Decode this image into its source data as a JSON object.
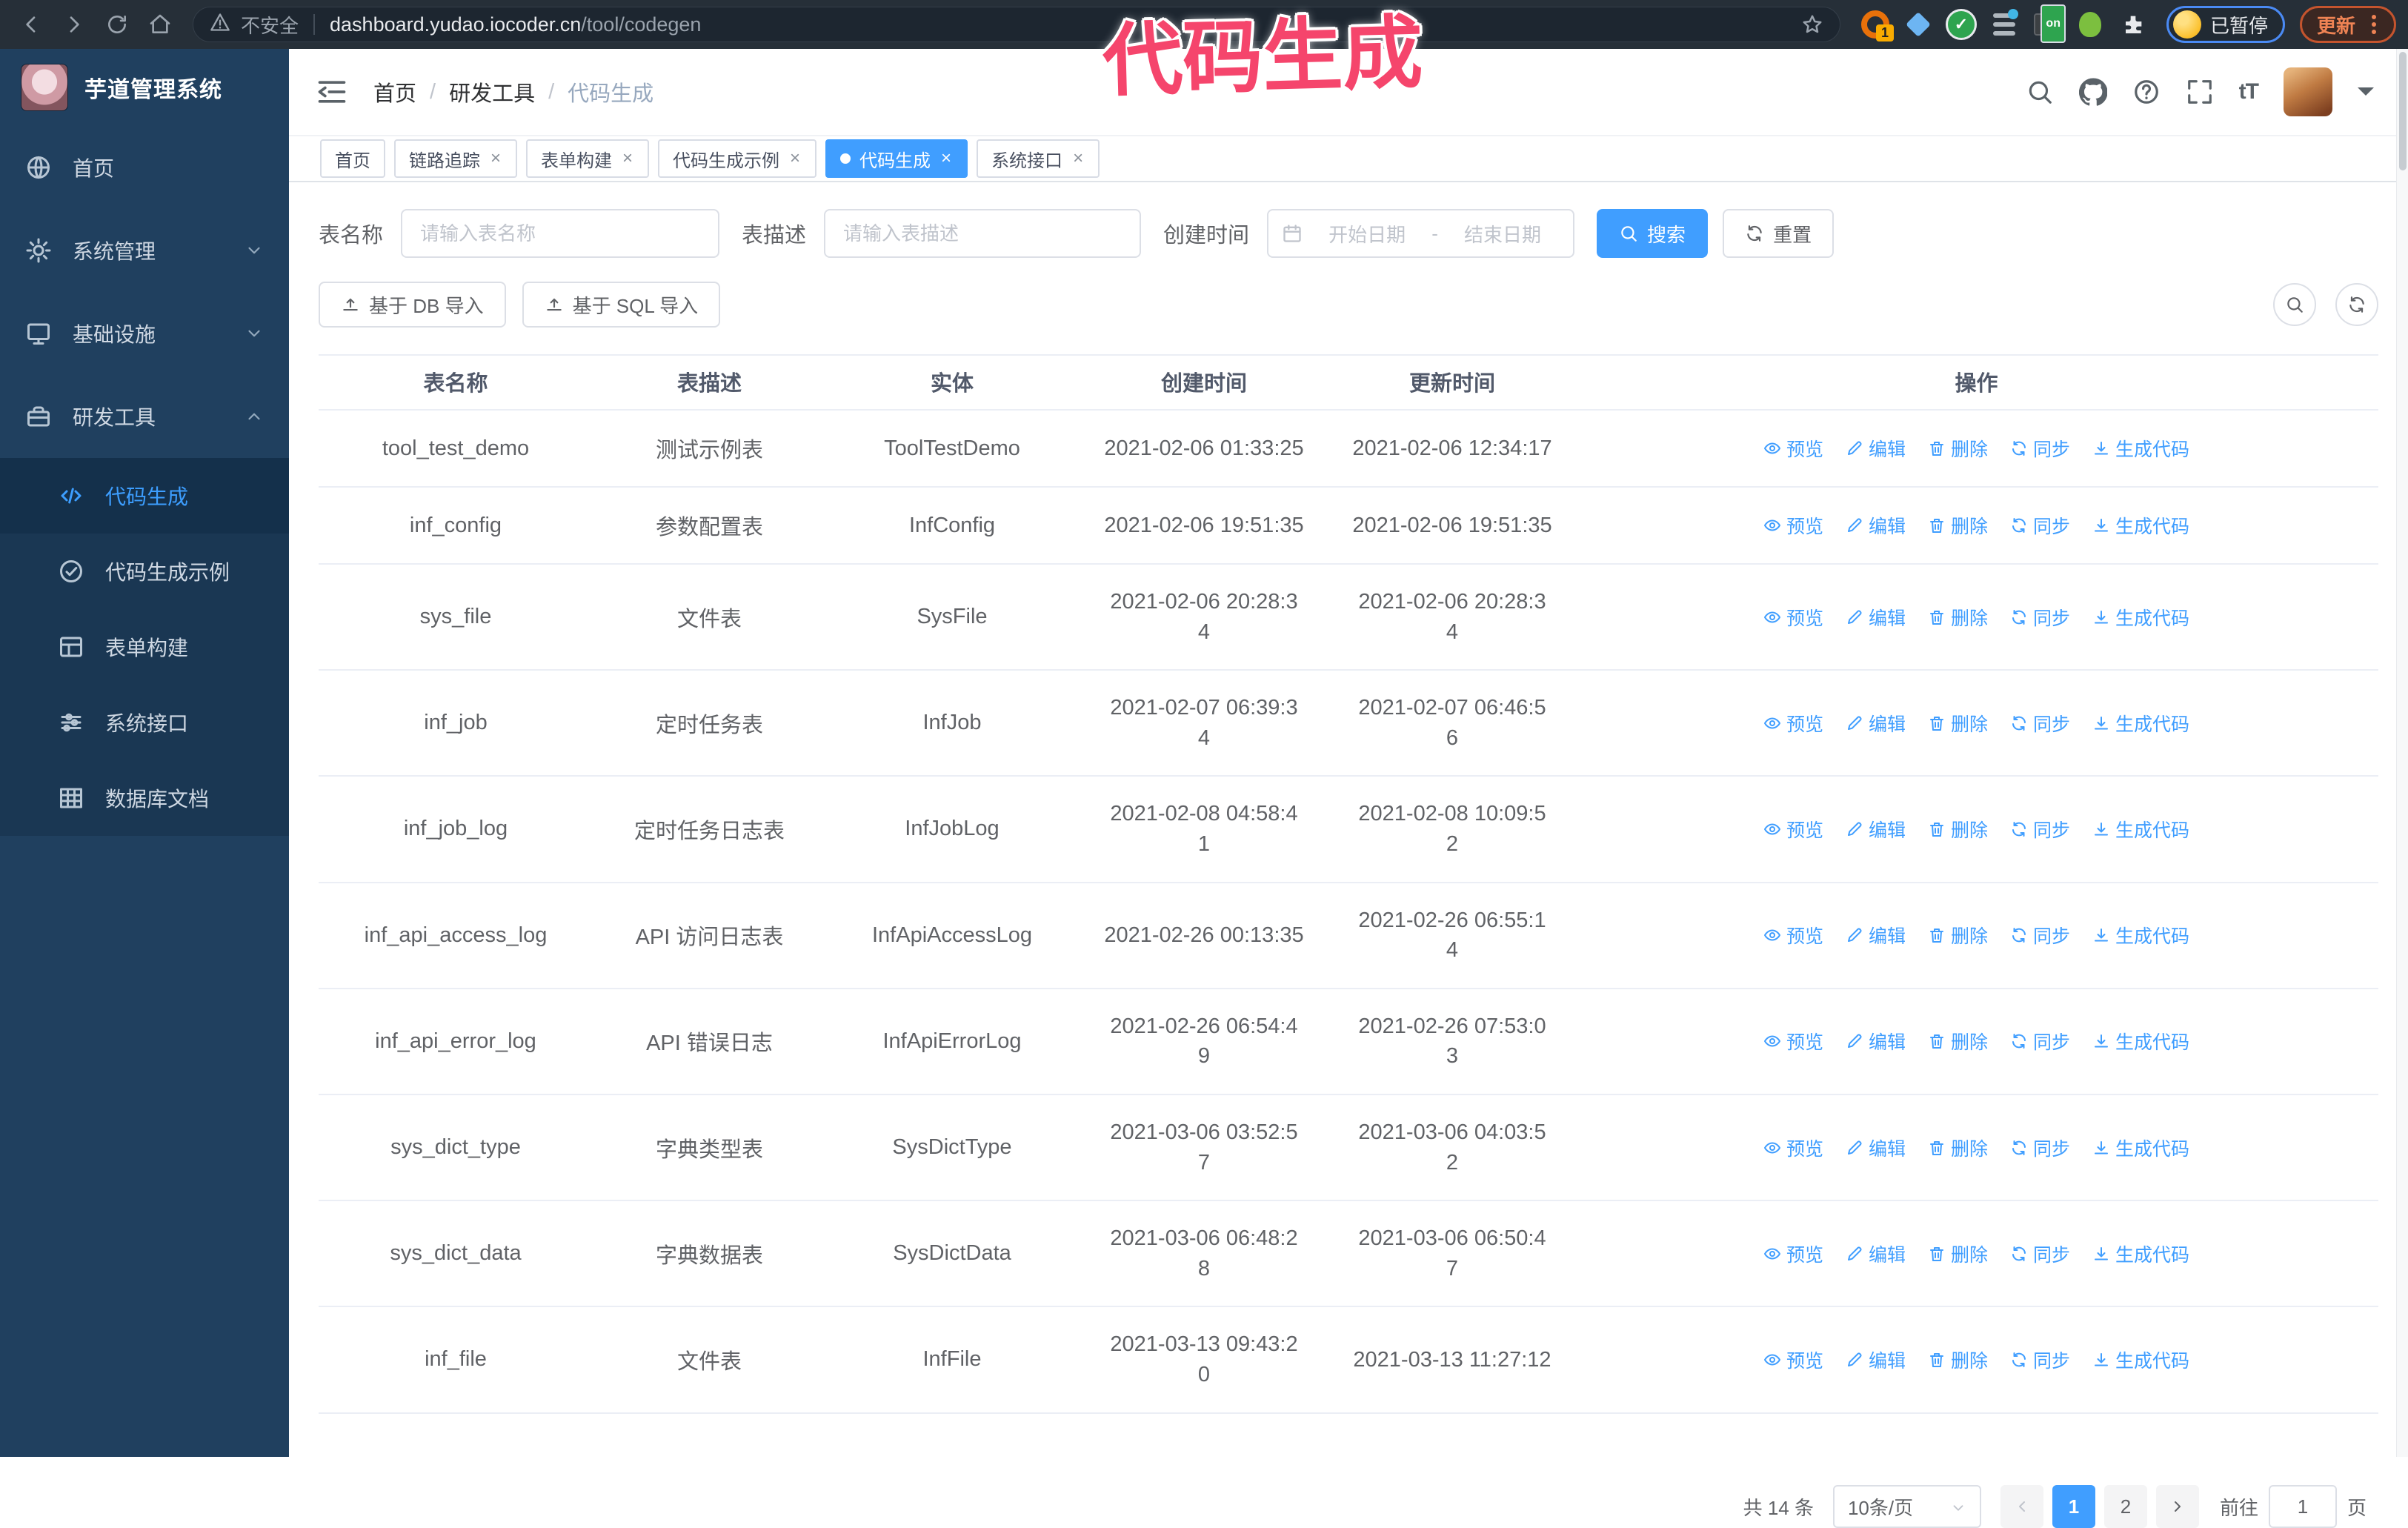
{
  "annotation": {
    "text": "代码生成"
  },
  "browser": {
    "security_label": "不安全",
    "url_host": "dashboard.yudao.iocoder.cn",
    "url_path": "/tool/codegen",
    "paused_badge": "已暂停",
    "update_button": "更新"
  },
  "sidebar": {
    "title": "芋道管理系统",
    "items": [
      {
        "key": "home",
        "icon": "dashboard",
        "label": "首页"
      },
      {
        "key": "system",
        "icon": "gear",
        "label": "系统管理",
        "chevron": "down"
      },
      {
        "key": "infra",
        "icon": "monitor",
        "label": "基础设施",
        "chevron": "down"
      },
      {
        "key": "devtools",
        "icon": "briefcase",
        "label": "研发工具",
        "chevron": "up",
        "expanded": true
      }
    ],
    "subitems": [
      {
        "key": "codegen",
        "icon": "code",
        "label": "代码生成",
        "active": true
      },
      {
        "key": "codegen-example",
        "icon": "badge",
        "label": "代码生成示例"
      },
      {
        "key": "form-builder",
        "icon": "form",
        "label": "表单构建"
      },
      {
        "key": "api",
        "icon": "sliders",
        "label": "系统接口"
      },
      {
        "key": "db-doc",
        "icon": "dbdoc",
        "label": "数据库文档"
      }
    ]
  },
  "header": {
    "breadcrumb": [
      "首页",
      "研发工具",
      "代码生成"
    ]
  },
  "tabs": [
    {
      "key": "home",
      "label": "首页",
      "closable": false,
      "active": false
    },
    {
      "key": "tracer",
      "label": "链路追踪",
      "closable": true,
      "active": false
    },
    {
      "key": "form-builder",
      "label": "表单构建",
      "closable": true,
      "active": false
    },
    {
      "key": "codegen-example",
      "label": "代码生成示例",
      "closable": true,
      "active": false
    },
    {
      "key": "codegen",
      "label": "代码生成",
      "closable": true,
      "active": true
    },
    {
      "key": "api",
      "label": "系统接口",
      "closable": true,
      "active": false
    }
  ],
  "filters": {
    "table_name_label": "表名称",
    "table_name_placeholder": "请输入表名称",
    "table_desc_label": "表描述",
    "table_desc_placeholder": "请输入表描述",
    "create_time_label": "创建时间",
    "date_start_placeholder": "开始日期",
    "date_separator": "-",
    "date_end_placeholder": "结束日期",
    "search_label": "搜索",
    "reset_label": "重置"
  },
  "toolbar": {
    "import_db_label": "基于 DB 导入",
    "import_sql_label": "基于 SQL 导入"
  },
  "table": {
    "columns": [
      "表名称",
      "表描述",
      "实体",
      "创建时间",
      "更新时间",
      "操作"
    ],
    "actions": [
      "预览",
      "编辑",
      "删除",
      "同步",
      "生成代码"
    ],
    "rows": [
      {
        "name": "tool_test_demo",
        "desc": "测试示例表",
        "entity": "ToolTestDemo",
        "created": "2021-02-06 01:33:25",
        "updated": "2021-02-06 12:34:17"
      },
      {
        "name": "inf_config",
        "desc": "参数配置表",
        "entity": "InfConfig",
        "created": "2021-02-06 19:51:35",
        "updated": "2021-02-06 19:51:35"
      },
      {
        "name": "sys_file",
        "desc": "文件表",
        "entity": "SysFile",
        "created": "2021-02-06 20:28:3\n4",
        "updated": "2021-02-06 20:28:3\n4"
      },
      {
        "name": "inf_job",
        "desc": "定时任务表",
        "entity": "InfJob",
        "created": "2021-02-07 06:39:3\n4",
        "updated": "2021-02-07 06:46:5\n6"
      },
      {
        "name": "inf_job_log",
        "desc": "定时任务日志表",
        "entity": "InfJobLog",
        "created": "2021-02-08 04:58:4\n1",
        "updated": "2021-02-08 10:09:5\n2"
      },
      {
        "name": "inf_api_access_log",
        "desc": "API 访问日志表",
        "entity": "InfApiAccessLog",
        "created": "2021-02-26 00:13:35",
        "updated": "2021-02-26 06:55:1\n4"
      },
      {
        "name": "inf_api_error_log",
        "desc": "API 错误日志",
        "entity": "InfApiErrorLog",
        "created": "2021-02-26 06:54:4\n9",
        "updated": "2021-02-26 07:53:0\n3"
      },
      {
        "name": "sys_dict_type",
        "desc": "字典类型表",
        "entity": "SysDictType",
        "created": "2021-03-06 03:52:5\n7",
        "updated": "2021-03-06 04:03:5\n2"
      },
      {
        "name": "sys_dict_data",
        "desc": "字典数据表",
        "entity": "SysDictData",
        "created": "2021-03-06 06:48:2\n8",
        "updated": "2021-03-06 06:50:4\n7"
      },
      {
        "name": "inf_file",
        "desc": "文件表",
        "entity": "InfFile",
        "created": "2021-03-13 09:43:2\n0",
        "updated": "2021-03-13 11:27:12"
      }
    ]
  },
  "pagination": {
    "total_text": "共 14 条",
    "page_size": "10条/页",
    "pages": [
      "1",
      "2"
    ],
    "active_page": "1",
    "goto_label": "前往",
    "goto_value": "1",
    "page_suffix": "页"
  },
  "colors": {
    "accent": "#409EFF",
    "sidebar_bg": "#20405f",
    "annotation": "#f5456c"
  }
}
